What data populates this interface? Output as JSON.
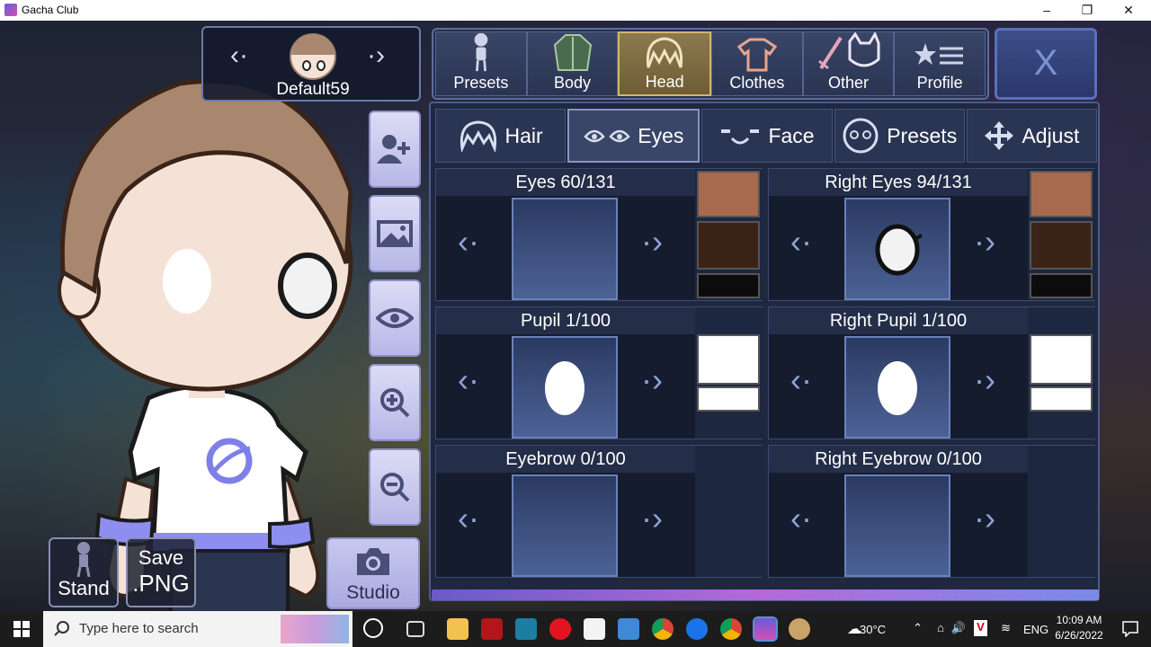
{
  "window": {
    "title": "Gacha Club",
    "minimize": "–",
    "maximize": "❐",
    "close": "✕"
  },
  "character": {
    "name": "Default59",
    "prev": "‹·",
    "next": "·›"
  },
  "bottom_buttons": {
    "stand": "Stand",
    "save_line1": "Save",
    "save_line2": ".PNG",
    "studio": "Studio"
  },
  "top_tabs": [
    {
      "label": "Presets",
      "icon": "mannequin-icon"
    },
    {
      "label": "Body",
      "icon": "jacket-icon"
    },
    {
      "label": "Head",
      "icon": "hair-icon"
    },
    {
      "label": "Clothes",
      "icon": "shirt-icon"
    },
    {
      "label": "Other",
      "icon": "sword-cat-icon"
    },
    {
      "label": "Profile",
      "icon": "star-list-icon"
    }
  ],
  "close_label": "X",
  "sub_tabs": [
    {
      "label": "Hair"
    },
    {
      "label": "Eyes"
    },
    {
      "label": "Face"
    },
    {
      "label": "Presets"
    },
    {
      "label": "Adjust"
    }
  ],
  "cells": [
    {
      "title": "Eyes 60/131"
    },
    {
      "title": "Right Eyes 94/131"
    },
    {
      "title": "Pupil 1/100"
    },
    {
      "title": "Right Pupil 1/100"
    },
    {
      "title": "Eyebrow 0/100"
    },
    {
      "title": "Right Eyebrow 0/100"
    }
  ],
  "colors": {
    "swatch_skin": "#a86a4e",
    "swatch_dark": "#3a2418",
    "swatch_black": "#0c0c0c",
    "swatch_white": "#ffffff",
    "active_tab": "#8c7a4e"
  },
  "taskbar": {
    "search_placeholder": "Type here to search",
    "weather": "30°C",
    "language": "ENG",
    "time": "10:09 AM",
    "date": "6/26/2022"
  }
}
